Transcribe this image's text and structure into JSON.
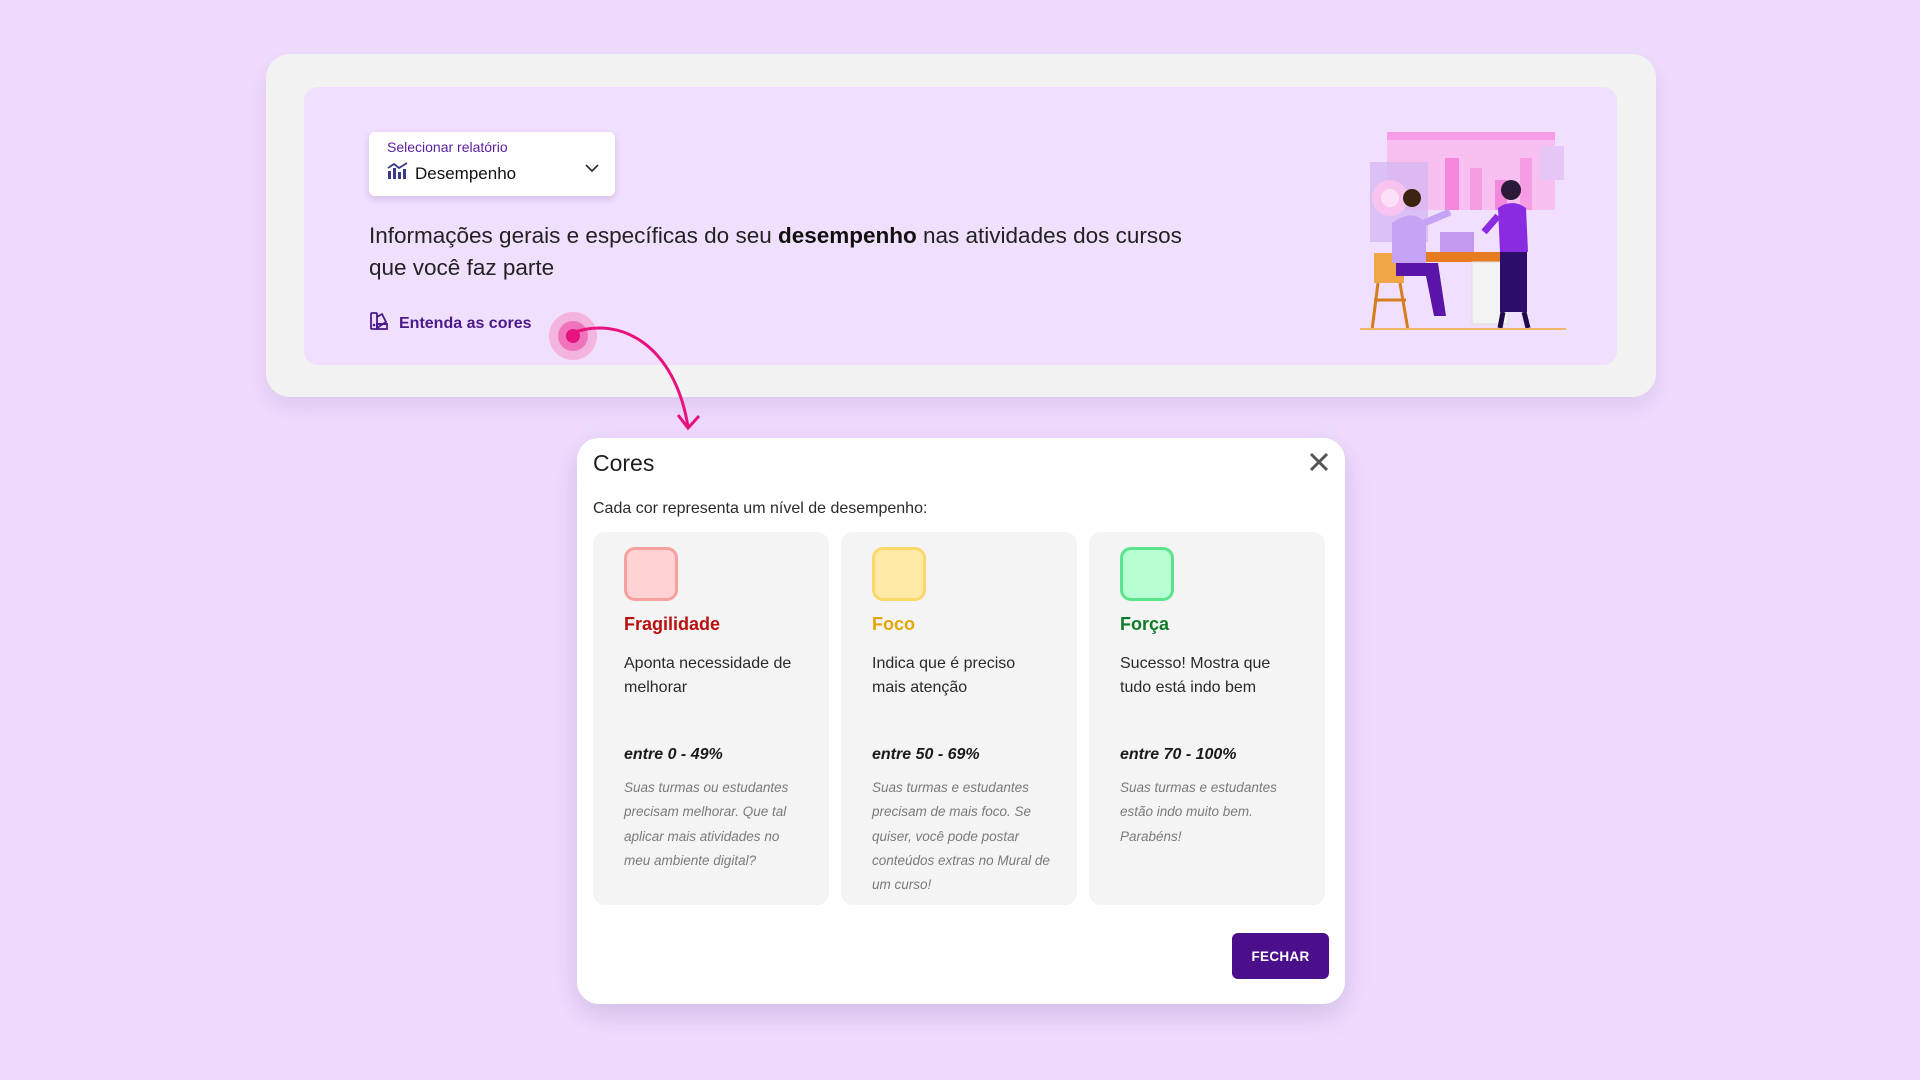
{
  "report_select": {
    "label": "Selecionar relatório",
    "value": "Desempenho",
    "icon": "chart-bars-icon"
  },
  "headline": {
    "part1": "Informações gerais e específicas do seu ",
    "bold": "desempenho",
    "part2": " nas atividades dos cursos que você faz parte"
  },
  "legend_link": {
    "label": "Entenda as cores",
    "icon": "palette-icon"
  },
  "modal": {
    "title": "Cores",
    "subtitle": "Cada cor representa um nível de desempenho:",
    "close_label": "FECHAR",
    "cards": [
      {
        "title": "Fragilidade",
        "description": "Aponta necessidade de melhorar",
        "range": "entre 0 - 49%",
        "note": "Suas turmas ou estudantes precisam melhorar. Que tal aplicar mais atividades no meu ambiente digital?",
        "title_color": "#b80f0f",
        "swatch_fill": "#ffd3d3",
        "swatch_border": "#f7a0a0"
      },
      {
        "title": "Foco",
        "description": "Indica que é preciso mais atenção",
        "range": "entre 50 - 69%",
        "note": "Suas turmas e estudantes precisam de mais foco. Se quiser, você pode postar conteúdos extras no Mural de um curso!",
        "title_color": "#e4a600",
        "swatch_fill": "#ffe9a6",
        "swatch_border": "#fcd869"
      },
      {
        "title": "Força",
        "description": "Sucesso! Mostra que tudo está indo bem",
        "range": "entre 70 - 100%",
        "note": "Suas turmas e estudantes estão indo muito bem. Parabéns!",
        "title_color": "#0e7a2a",
        "swatch_fill": "#b5ffd3",
        "swatch_border": "#5ce48c"
      }
    ]
  },
  "colors": {
    "background": "#efdcfd",
    "accent": "#4b0f8c",
    "pointer": "#e8127f"
  }
}
